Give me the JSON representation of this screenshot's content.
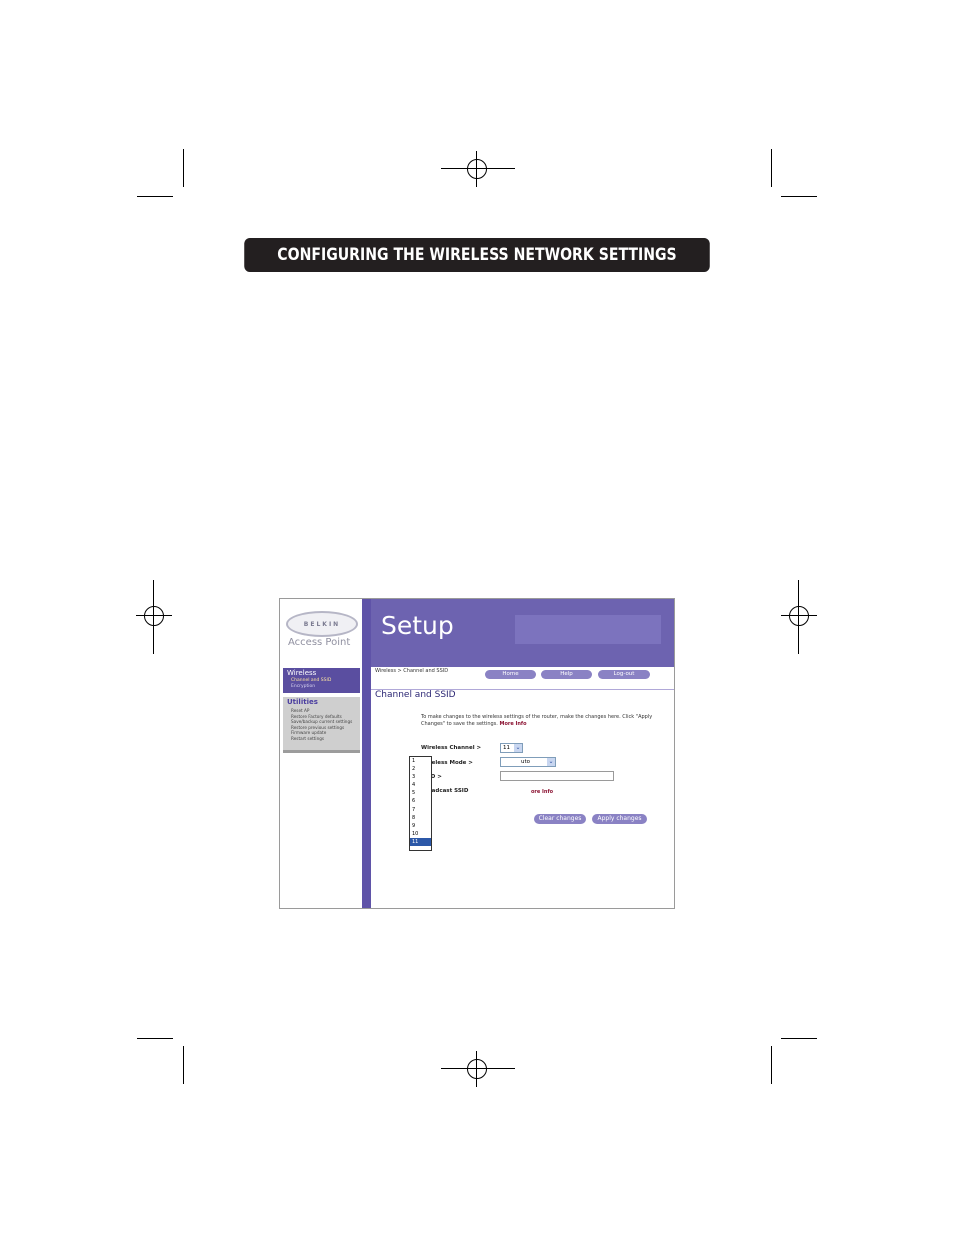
{
  "banner": {
    "title": "CONFIGURING THE WIRELESS NETWORK SETTINGS"
  },
  "screenshot": {
    "logo": {
      "brand": "BELKIN",
      "product": "Access Point"
    },
    "sidebar": {
      "wireless": {
        "title": "Wireless",
        "items": [
          "Channel and SSID",
          "Encryption"
        ]
      },
      "utilities": {
        "title": "Utilities",
        "items": [
          "Reset AP",
          "Restore Factory defaults",
          "Save/backup current settings",
          "Restore previous settings",
          "Firmware update",
          "Restart settings"
        ]
      }
    },
    "header": {
      "title": "Setup"
    },
    "breadcrumb": "Wireless > Channel and SSID",
    "nav": {
      "home": "Home",
      "help": "Help",
      "logout": "Log-out"
    },
    "page_title": "Channel and SSID",
    "intro": "To make changes to the wireless settings of the router, make the changes here. Click \"Apply Changes\" to save the settings.",
    "more_info": "More Info",
    "form": {
      "channel_label": "Wireless Channel >",
      "channel_value": "11",
      "channel_options": [
        "1",
        "2",
        "3",
        "4",
        "5",
        "6",
        "7",
        "8",
        "9",
        "10",
        "11"
      ],
      "mode_label": "Wireless Mode >",
      "mode_value": "uto",
      "ssid_label": "SSID >",
      "broadcast_label": "Broadcast SSID",
      "broadcast_more": "ore Info"
    },
    "buttons": {
      "clear": "Clear changes",
      "apply": "Apply changes"
    }
  }
}
